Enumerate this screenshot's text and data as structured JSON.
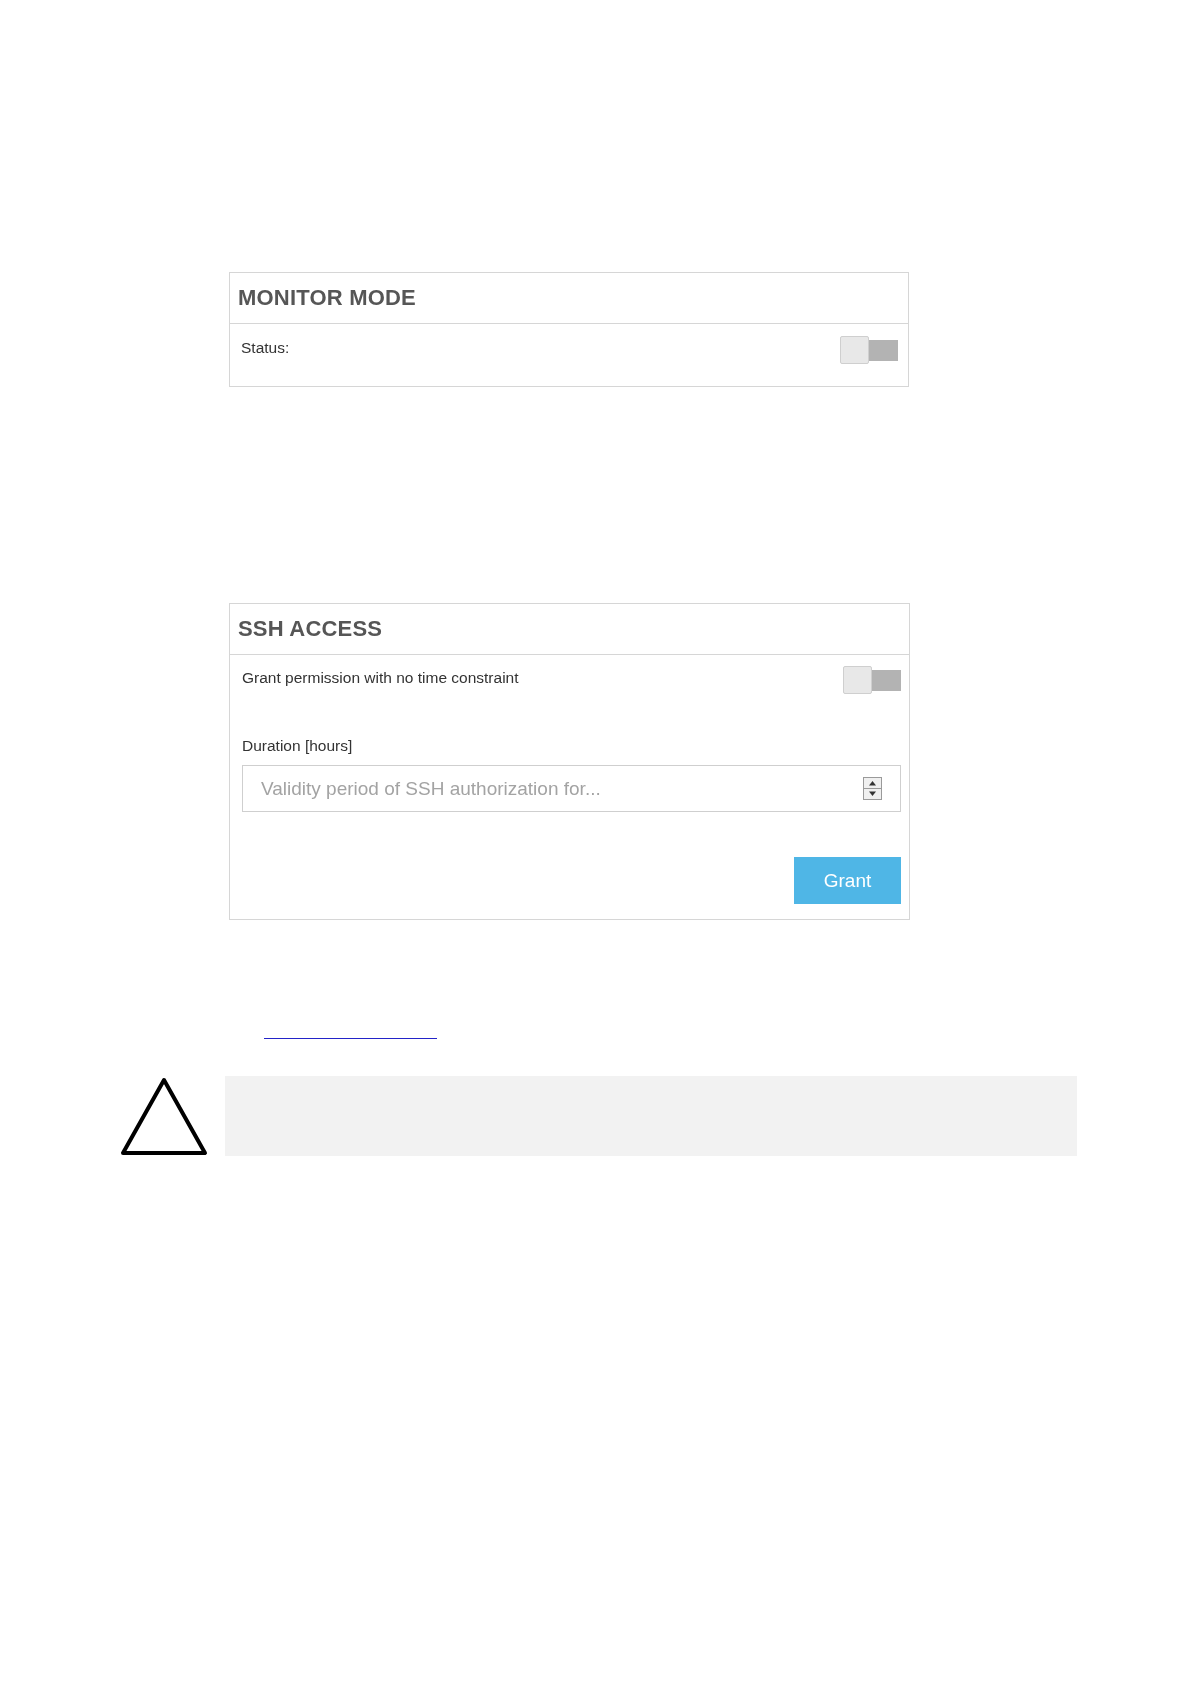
{
  "monitor_mode": {
    "title": "MONITOR MODE",
    "status": {
      "label": "Status:",
      "on": false
    }
  },
  "ssh_access": {
    "title": "SSH ACCESS",
    "no_time_constraint": {
      "label": "Grant permission with no time constraint",
      "on": false
    },
    "duration": {
      "label": "Duration [hours]",
      "placeholder": "Validity period of SSH authorization for..."
    },
    "grant_button": "Grant"
  }
}
